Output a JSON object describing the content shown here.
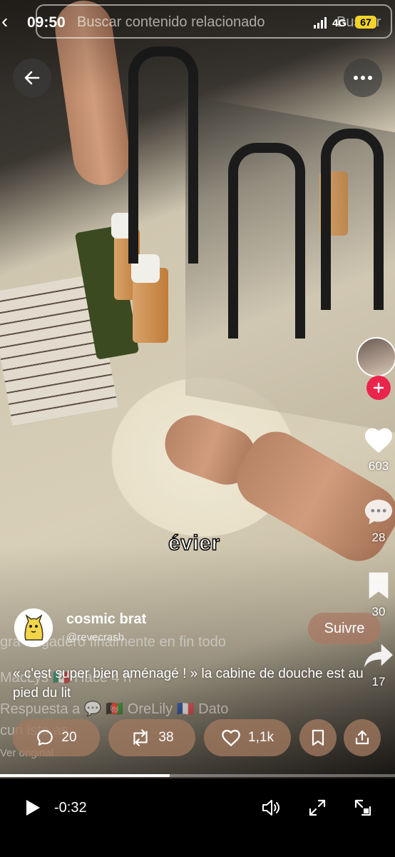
{
  "status_bar": {
    "time": "09:50",
    "network": "4G",
    "battery": "67"
  },
  "search": {
    "placeholder": "Buscar contenido relacionado",
    "button_label": "Buscar"
  },
  "video": {
    "caption_overlay": "évier",
    "background_text": [
      "gra fregadero finalmente en fin todo",
      "MacLys 🇲🇽 Hace 4 h",
      "Respuesta a 💬 🇦🇫 OreLily 🇫🇷 Dato",
      "curi    isto         as",
      "Ver original"
    ]
  },
  "side_actions": {
    "likes": "603",
    "comments": "28",
    "saves": "30",
    "shares": "17"
  },
  "post": {
    "username": "cosmic brat",
    "handle": "@revecrash",
    "follow_label": "Suivre",
    "description": "« c'est super bien aménagé ! » la cabine de douche est au pied du lit"
  },
  "engagement": {
    "comments": "20",
    "reposts": "38",
    "likes": "1,1k"
  },
  "player": {
    "time_remaining": "-0:32",
    "progress": 0.43
  },
  "colors": {
    "follow_bg": "#a57a66",
    "plus_red": "#e9254b",
    "battery_yellow": "#f2d32c"
  }
}
